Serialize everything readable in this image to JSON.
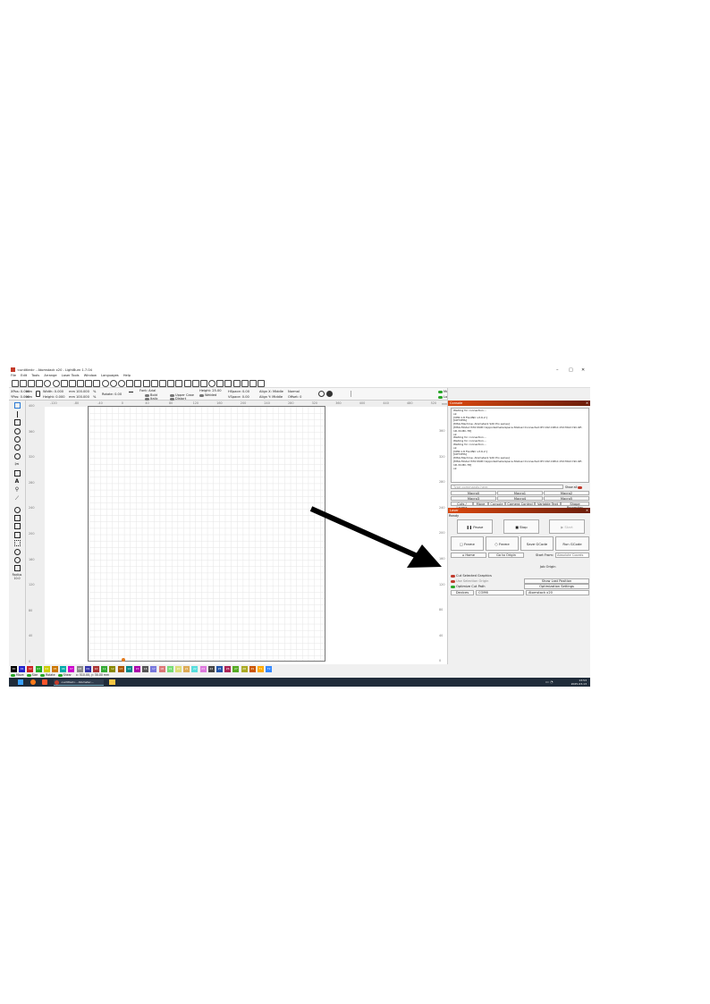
{
  "window": {
    "title": "<untitled> - Atomstack x20 - LightBurn 1.7.04",
    "controls": [
      "–",
      "□",
      "✕"
    ]
  },
  "menu": [
    "File",
    "Edit",
    "Tools",
    "Arrange",
    "Laser Tools",
    "Window",
    "Languages",
    "Help"
  ],
  "propbar": {
    "xpos": "XPos: 0.000",
    "ypos": "YPos: 0.000",
    "width": "Width: 0.000",
    "height": "Height: 0.000",
    "mm": "mm",
    "w_pct": "100.000",
    "h_pct": "100.000",
    "pct": "%",
    "rotate": "Rotate: 0.00",
    "font": "Font: Arial",
    "height_txt": "Height: 25.00",
    "hspace": "HSpace: 0.00",
    "vspace": "VSpace: 0.00",
    "alignx": "Align X: Middle",
    "aligny": "Align Y: Middle",
    "normal": "Normal",
    "offset": "Offset: 0",
    "bold": "Bold",
    "italic": "Italic",
    "upper": "Upper Case",
    "distort": "Distort",
    "welded": "Welded",
    "move_group": "Move as group",
    "lock_inner": "Lock inner objects",
    "padding_label": "Padding",
    "padding_value": "0.0"
  },
  "left_tools": {
    "radius_label": "Radius",
    "radius_value": "10.0"
  },
  "ruler_left": [
    "400",
    "360",
    "320",
    "280",
    "240",
    "200",
    "160",
    "120",
    "80",
    "40",
    "0"
  ],
  "ruler_left_right": [
    "360",
    "320",
    "280",
    "240",
    "200",
    "160",
    "120",
    "80",
    "40",
    "0"
  ],
  "ruler_top": [
    "-120",
    "-80",
    "-40",
    "0",
    "40",
    "80",
    "120",
    "160",
    "200",
    "240",
    "280",
    "320",
    "360",
    "400",
    "440",
    "480",
    "520"
  ],
  "mm_label": "mm",
  "console": {
    "title": "Console",
    "lines": [
      "Waiting for connection...",
      "ok",
      "[VER:1.8 FluidNC v3.6.2:]",
      "[OPT:PHS]",
      "[MSG:Machine: Atomstack S20 Pro series]",
      "[MSG:Mode=STA:SSID=Lippodelmekerspace:Status=Connected:IP=192.168.0.152:MAC=9C-9E-1D-32-BC-78]",
      "ok",
      "Waiting for connection...",
      "Waiting for connection...",
      "Waiting for connection...",
      "ok",
      "[VER:1.8 FluidNC v3.6.2:]",
      "[OPT:PHS]",
      "[MSG:Machine: Atomstack S20 Pro series]",
      "[MSG:Mode=STA:SSID=Lippodelmekerspace:Status=Connected:IP=192.168.0.152:MAC=9C-9E-1D-32-BC-78]",
      "ok"
    ],
    "cmd_placeholder": "Type commands here",
    "show_all": "Show all"
  },
  "macros": [
    "Macro0",
    "Macro1",
    "Macro2",
    "Macro3",
    "Macro4",
    "Macro5"
  ],
  "tabs": [
    "Cuts / Layers",
    "Move",
    "Console",
    "Camera Control",
    "Variable Text",
    "Shape Properties"
  ],
  "laser": {
    "title": "Laser",
    "status": "Ready",
    "pause": "Pause",
    "stop": "Stop",
    "start": "Start",
    "frame1": "Frame",
    "frame2": "Frame",
    "save_gcode": "Save GCode",
    "run_gcode": "Run GCode",
    "home": "Home",
    "go_origin": "Go to Origin",
    "start_from_label": "Start From:",
    "start_from_value": "Absolute Coords",
    "job_origin": "Job Origin",
    "cut_selected": "Cut Selected Graphics",
    "use_sel_origin": "Use Selection Origin",
    "optimize": "Optimize Cut Path",
    "show_last": "Show Last Position",
    "opt_settings": "Optimization Settings",
    "devices": "Devices",
    "port": "COM6",
    "device": "Atomstack x20"
  },
  "bottom_tabs": [
    "Laser",
    "Material Library"
  ],
  "palette": [
    "00",
    "01",
    "02",
    "03",
    "04",
    "05",
    "06",
    "07",
    "08",
    "09",
    "10",
    "11",
    "12",
    "13",
    "14",
    "15",
    "16",
    "17",
    "18",
    "19",
    "20",
    "21",
    "22",
    "23",
    "24",
    "25",
    "26",
    "27",
    "28",
    "29",
    "T1",
    "T2"
  ],
  "palette_colors": [
    "#000000",
    "#2222cc",
    "#cc2222",
    "#22aa22",
    "#cccc00",
    "#cc7700",
    "#00aaaa",
    "#cc00cc",
    "#888888",
    "#3333aa",
    "#aa3333",
    "#33aa33",
    "#888800",
    "#aa5500",
    "#008888",
    "#aa00aa",
    "#555555",
    "#7777dd",
    "#dd7777",
    "#77dd77",
    "#dddd77",
    "#ddaa55",
    "#55dddd",
    "#dd77dd",
    "#444444",
    "#2255aa",
    "#aa2255",
    "#55aa22",
    "#aaaa22",
    "#cc5500",
    "#ffaa00",
    "#3388ff"
  ],
  "status": {
    "move": "Move",
    "size": "Size",
    "rotate": "Rotate",
    "shear": "Shear",
    "coords": "x: 510.00, y: 30.00 mm"
  },
  "taskbar": {
    "app": "<untitled> - Atomstac...",
    "time": "13:53",
    "date": "2025-03-13"
  }
}
